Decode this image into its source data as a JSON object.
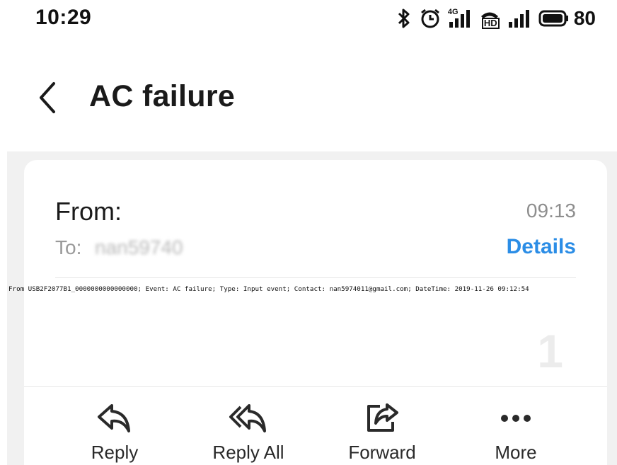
{
  "status_bar": {
    "time": "10:29",
    "icons": [
      "bluetooth-icon",
      "alarm-icon",
      "signal-4g-icon",
      "hd-call-icon",
      "signal-icon",
      "battery-icon"
    ],
    "network_label": "4G",
    "hd_label": "HD",
    "battery_level": "80"
  },
  "header": {
    "title": "AC failure",
    "back_icon": "chevron-left-icon"
  },
  "email": {
    "from_label": "From:",
    "time": "09:13",
    "to_label": "To:",
    "to_value": "nan59740",
    "details_label": "Details",
    "body": "From USB2F2077B1_0000000000000000;  Event: AC failure;  Type: Input event;  Contact: nan5974011@gmail.com;  DateTime: 2019-11-26 09:12:54",
    "page_number": "1"
  },
  "actions": [
    {
      "label": "Reply",
      "icon": "reply-icon"
    },
    {
      "label": "Reply All",
      "icon": "reply-all-icon"
    },
    {
      "label": "Forward",
      "icon": "forward-icon"
    },
    {
      "label": "More",
      "icon": "more-icon"
    }
  ],
  "colors": {
    "accent": "#2b8de6",
    "background": "#f1f1f1",
    "card": "#ffffff"
  }
}
